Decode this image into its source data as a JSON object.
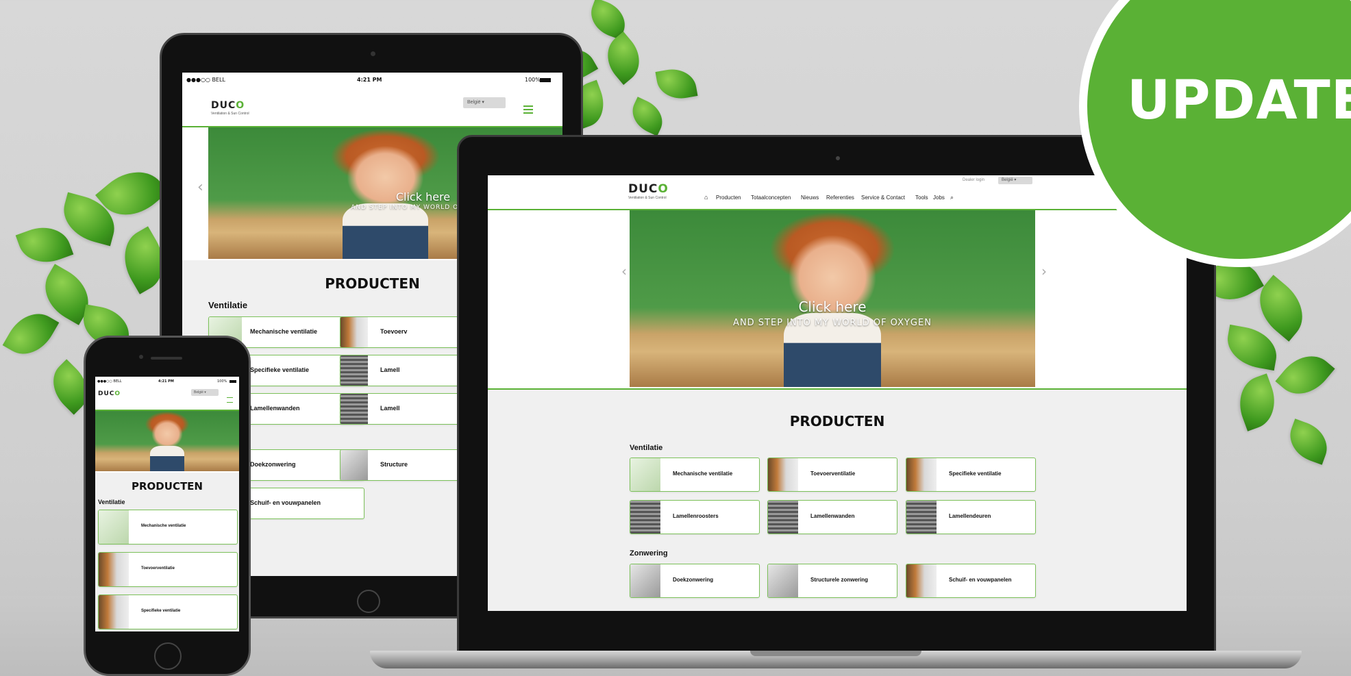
{
  "badge": {
    "text": "UPDATE !"
  },
  "brand": {
    "logo_main": "DUC",
    "logo_o": "O",
    "logo_sub": "Ventilation & Sun Control"
  },
  "status": {
    "carrier": "●●●○○ BELL",
    "time": "4:21 PM",
    "battery": "100%"
  },
  "country_select": {
    "tablet": "België",
    "phone": "België",
    "desktop": "België"
  },
  "hero": {
    "title": "Click here",
    "subtitle": "AND STEP INTO MY WORLD OF OXYGEN",
    "prev": "‹",
    "next": "›"
  },
  "desktop": {
    "dealer_login": "Dealer login",
    "nav": [
      "Producten",
      "Totaalconcepten",
      "Nieuws",
      "Referenties",
      "Service & Contact",
      "Tools",
      "Jobs"
    ],
    "home_icon": "⌂",
    "search_icon": "⌕"
  },
  "section": {
    "title": "PRODUCTEN",
    "group_ventilatie": "Ventilatie",
    "group_zonwering": "Zonwering"
  },
  "products": {
    "ventilatie": [
      "Mechanische ventilatie",
      "Toevoerventilatie",
      "Specifieke ventilatie",
      "Lamellenroosters",
      "Lamellenwanden",
      "Lamellendeuren"
    ],
    "zonwering": [
      "Doekzonwering",
      "Structurele zonwering",
      "Schuif- en vouwpanelen"
    ]
  },
  "tablet_visible": {
    "left": [
      "Mechanische ventilatie",
      "Specifieke ventilatie",
      "Lamellenwanden",
      "Doekzonwering",
      "Schuif- en vouwpanelen"
    ],
    "right": [
      "Toevoerv",
      "Lamell",
      "Lamell",
      "Structure"
    ],
    "zonwering_partial": "ng"
  },
  "phone_visible": [
    "Mechanische ventilatie",
    "Toevoerventilatie",
    "Specifieke ventilatie"
  ]
}
